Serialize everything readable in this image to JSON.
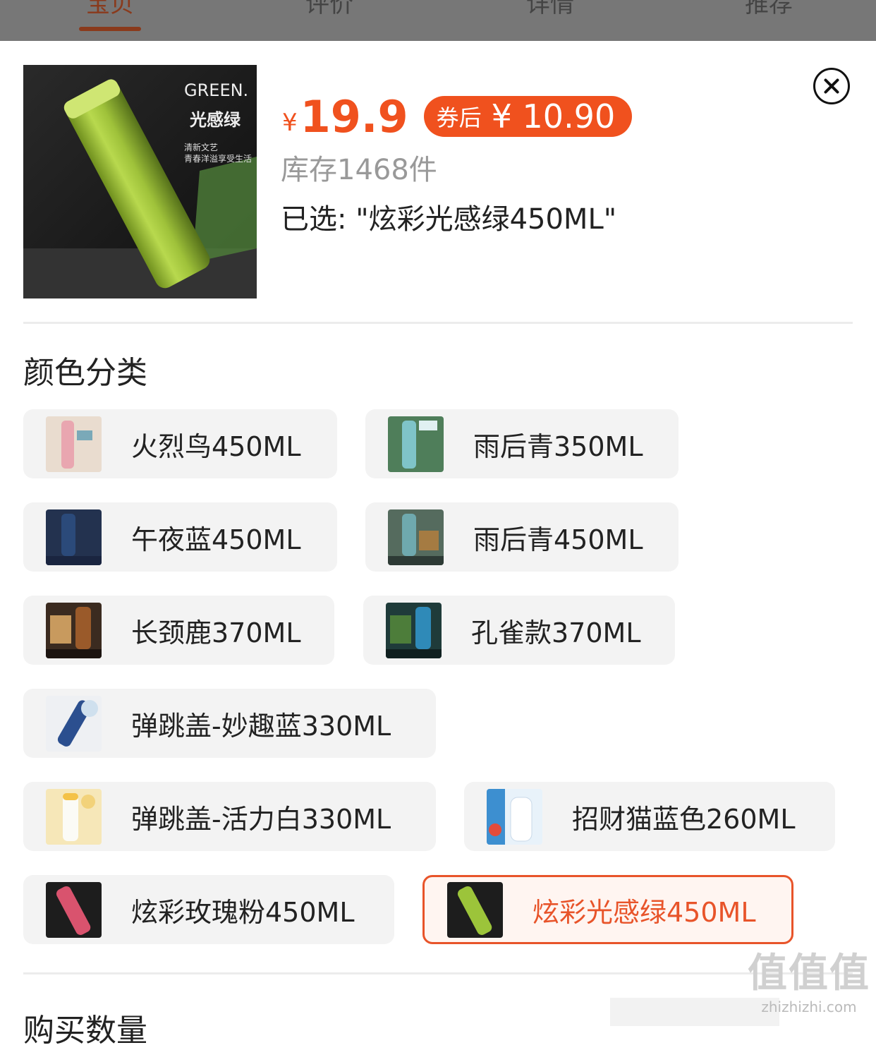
{
  "top_tabs": [
    {
      "label": "宝贝",
      "active": true
    },
    {
      "label": "评价",
      "active": false
    },
    {
      "label": "详情",
      "active": false
    },
    {
      "label": "推荐",
      "active": false
    }
  ],
  "product": {
    "image_text_1": "GREEN.",
    "image_text_2": "光感绿",
    "image_text_3": "清新文艺",
    "image_text_4": "青春洋溢享受生活",
    "currency": "¥",
    "price": "19.9",
    "coupon_label": "券后",
    "coupon_price": "¥ 10.90",
    "stock": "库存1468件",
    "selected": "已选: \"炫彩光感绿450ML\""
  },
  "section_color": {
    "title": "颜色分类",
    "options": [
      {
        "label": "火烈鸟450ML",
        "active": false,
        "swatch": "#e9a6b0"
      },
      {
        "label": "雨后青350ML",
        "active": false,
        "swatch": "#7fc4c8"
      },
      {
        "label": "午夜蓝450ML",
        "active": false,
        "swatch": "#2b4a7a"
      },
      {
        "label": "雨后青450ML",
        "active": false,
        "swatch": "#6fa9ae"
      },
      {
        "label": "长颈鹿370ML",
        "active": false,
        "swatch": "#9a5a2a"
      },
      {
        "label": "孔雀款370ML",
        "active": false,
        "swatch": "#2f8ab8"
      },
      {
        "label": "弹跳盖-妙趣蓝330ML",
        "active": false,
        "swatch": "#2b4f8f"
      },
      {
        "label": "弹跳盖-活力白330ML",
        "active": false,
        "swatch": "#f3e6c0"
      },
      {
        "label": "招财猫蓝色260ML",
        "active": false,
        "swatch": "#3d8fd0"
      },
      {
        "label": "炫彩玫瑰粉450ML",
        "active": false,
        "swatch": "#d9536e"
      },
      {
        "label": "炫彩光感绿450ML",
        "active": true,
        "swatch": "#9cc43a"
      }
    ]
  },
  "section_quantity": {
    "title": "购买数量"
  },
  "watermark": {
    "big": "值值值",
    "small": "zhizhizhi.com"
  },
  "colors": {
    "accent": "#f0511e",
    "selected_border": "#e8542a"
  }
}
